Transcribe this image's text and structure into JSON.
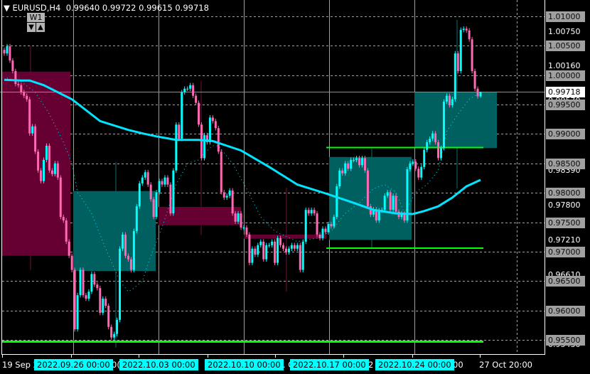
{
  "header": {
    "symbol": "EURUSD,H4",
    "open": "0.99640",
    "high": "0.99722",
    "low": "0.99615",
    "close": "0.99718",
    "menu_icon": "triangle-down-icon"
  },
  "overlay_control": {
    "timeframe_label": "W1",
    "down_icon": "▼",
    "up_icon": "▲"
  },
  "colors": {
    "background": "#000000",
    "bull": "#00ffff",
    "bear": "#ff69b4",
    "bull_zone": "#006060",
    "bear_zone": "#660033",
    "grid": "#a0a0a0",
    "slow_ma": "#00e5ff",
    "level_line": "#00ff00"
  },
  "price_axis": {
    "boxed_levels": [
      "1.01000",
      "1.00500",
      "1.00000",
      "0.99500",
      "0.99000",
      "0.98500",
      "0.98000",
      "0.97500",
      "0.97000",
      "0.96500",
      "0.96000",
      "0.95500"
    ],
    "plain_levels": [
      "1.00750",
      "1.00160",
      "0.99570",
      "0.98390",
      "0.97800",
      "0.97210",
      "0.96610",
      "0.95430"
    ],
    "current_price": "0.99718"
  },
  "time_axis": {
    "fragments": [
      {
        "text": "19 Sep 2"
      },
      {
        "text": "0("
      },
      {
        "text": ". C"
      },
      {
        "text": "2"
      },
      {
        "text": "00"
      },
      {
        "text": "27 Oct 20:00"
      }
    ],
    "week_labels": [
      "2022.09.26 00:00",
      "2022.10.03 00:00",
      "2022.10.10 00:00",
      "2022.10.17 00:00",
      "2022.10.24 00:00"
    ]
  },
  "chart_data": {
    "type": "candlestick",
    "title": "EURUSD,H4",
    "ylim": [
      0.952,
      1.0128
    ],
    "grid": true,
    "last_candle": {
      "open": 0.9964,
      "high": 0.99722,
      "low": 0.99615,
      "close": 0.99718
    },
    "h4_closes": [
      1.0037,
      1.0049,
      1.0025,
      1.0007,
      0.9985,
      0.9983,
      0.9971,
      0.9965,
      0.9959,
      0.9901,
      0.9913,
      0.987,
      0.9838,
      0.982,
      0.9856,
      0.988,
      0.9838,
      0.9832,
      0.985,
      0.9826,
      0.9759,
      0.9753,
      0.9717,
      0.9693,
      0.9669,
      0.9568,
      0.9626,
      0.9669,
      0.9626,
      0.962,
      0.9632,
      0.9662,
      0.9644,
      0.9638,
      0.9596,
      0.962,
      0.9608,
      0.9572,
      0.9554,
      0.956,
      0.9584,
      0.9705,
      0.9729,
      0.9693,
      0.9687,
      0.9669,
      0.9735,
      0.9777,
      0.9816,
      0.9826,
      0.9835,
      0.9814,
      0.9789,
      0.9759,
      0.9801,
      0.982,
      0.9814,
      0.9826,
      0.9814,
      0.9765,
      0.9838,
      0.9916,
      0.9892,
      0.9971,
      0.9977,
      0.9977,
      0.9983,
      0.9965,
      0.9953,
      0.9916,
      0.9859,
      0.9898,
      0.9886,
      0.9928,
      0.9922,
      0.991,
      0.987,
      0.9801,
      0.9792,
      0.9795,
      0.9804,
      0.9765,
      0.9751,
      0.9765,
      0.9741,
      0.9741,
      0.9729,
      0.9681,
      0.9705,
      0.9695,
      0.9711,
      0.9717,
      0.9687,
      0.9711,
      0.9711,
      0.9717,
      0.9681,
      0.9723,
      0.9711,
      0.9705,
      0.9699,
      0.9705,
      0.9711,
      0.9705,
      0.9711,
      0.9669,
      0.9717,
      0.9771,
      0.9765,
      0.9771,
      0.9765,
      0.9729,
      0.9723,
      0.9739,
      0.9733,
      0.9747,
      0.9743,
      0.9759,
      0.9811,
      0.9838,
      0.9833,
      0.985,
      0.9841,
      0.9856,
      0.9856,
      0.9859,
      0.9847,
      0.9859,
      0.9838,
      0.9777,
      0.9763,
      0.9772,
      0.9753,
      0.977,
      0.9771,
      0.9795,
      0.9801,
      0.9771,
      0.9795,
      0.9768,
      0.9759,
      0.9765,
      0.9753,
      0.984,
      0.985,
      0.9853,
      0.9841,
      0.9826,
      0.9844,
      0.9873,
      0.9886,
      0.9892,
      0.9901,
      0.9886,
      0.9859,
      0.9876,
      0.9955,
      0.9965,
      0.9949,
      0.9959,
      1.0037,
      1.0007,
      1.0077,
      1.0079,
      1.0076,
      1.0061,
      1.0007,
      0.9977,
      0.9964,
      0.99718
    ],
    "weekly_candles": [
      {
        "week": "2022.09.19",
        "open": 1.0006,
        "close": 0.9693,
        "high": 1.005,
        "low": 0.9669
      },
      {
        "week": "2022.09.26",
        "open": 0.9667,
        "close": 0.9803,
        "high": 0.9852,
        "low": 0.9537
      },
      {
        "week": "2022.10.03",
        "open": 0.9776,
        "close": 0.9745,
        "high": 0.999,
        "low": 0.9728
      },
      {
        "week": "2022.10.10",
        "open": 0.9729,
        "close": 0.9722,
        "high": 0.9809,
        "low": 0.9632
      },
      {
        "week": "2022.10.17",
        "open": 0.972,
        "close": 0.9861,
        "high": 0.9875,
        "low": 0.9707
      },
      {
        "week": "2022.10.24",
        "open": 0.9876,
        "close": 0.99718,
        "high": 1.0094,
        "low": 0.9807
      }
    ],
    "slow_ma": [
      [
        0,
        0.9992
      ],
      [
        6,
        0.9991
      ],
      [
        9,
        0.9991
      ],
      [
        14,
        0.9983
      ],
      [
        24,
        0.9959
      ],
      [
        34,
        0.9922
      ],
      [
        44,
        0.9907
      ],
      [
        49,
        0.9901
      ],
      [
        54,
        0.9896
      ],
      [
        61,
        0.989
      ],
      [
        69,
        0.989
      ],
      [
        74,
        0.9888
      ],
      [
        79,
        0.988
      ],
      [
        84,
        0.9872
      ],
      [
        94,
        0.9844
      ],
      [
        104,
        0.9814
      ],
      [
        114,
        0.9799
      ],
      [
        124,
        0.9783
      ],
      [
        131,
        0.9771
      ],
      [
        139,
        0.9765
      ],
      [
        145,
        0.9764
      ],
      [
        149,
        0.9769
      ],
      [
        154,
        0.9777
      ],
      [
        159,
        0.9792
      ],
      [
        164,
        0.9811
      ],
      [
        169,
        0.9822
      ]
    ],
    "fast_ma": [
      [
        1,
        0.9995
      ],
      [
        6,
        0.9989
      ],
      [
        11,
        0.9971
      ],
      [
        16,
        0.9934
      ],
      [
        21,
        0.9886
      ],
      [
        24,
        0.985
      ],
      [
        26,
        0.9801
      ],
      [
        31,
        0.9765
      ],
      [
        36,
        0.9705
      ],
      [
        41,
        0.965
      ],
      [
        44,
        0.9632
      ],
      [
        46,
        0.9638
      ],
      [
        49,
        0.965
      ],
      [
        52,
        0.9693
      ],
      [
        56,
        0.9741
      ],
      [
        61,
        0.9814
      ],
      [
        65,
        0.985
      ],
      [
        69,
        0.9856
      ],
      [
        71,
        0.9868
      ],
      [
        74,
        0.988
      ],
      [
        76,
        0.988
      ],
      [
        81,
        0.985
      ],
      [
        86,
        0.9807
      ],
      [
        91,
        0.9759
      ],
      [
        96,
        0.9735
      ],
      [
        104,
        0.9717
      ],
      [
        111,
        0.9723
      ],
      [
        116,
        0.9735
      ],
      [
        121,
        0.9765
      ],
      [
        126,
        0.9783
      ],
      [
        131,
        0.9807
      ],
      [
        135,
        0.9814
      ],
      [
        139,
        0.9801
      ],
      [
        142,
        0.9765
      ],
      [
        146,
        0.9801
      ],
      [
        150,
        0.9814
      ],
      [
        154,
        0.9838
      ],
      [
        157,
        0.9904
      ],
      [
        161,
        0.9934
      ],
      [
        165,
        0.9959
      ],
      [
        169,
        0.9971
      ]
    ],
    "horizontal_levels": [
      0.9877,
      0.9706,
      0.9547
    ]
  }
}
